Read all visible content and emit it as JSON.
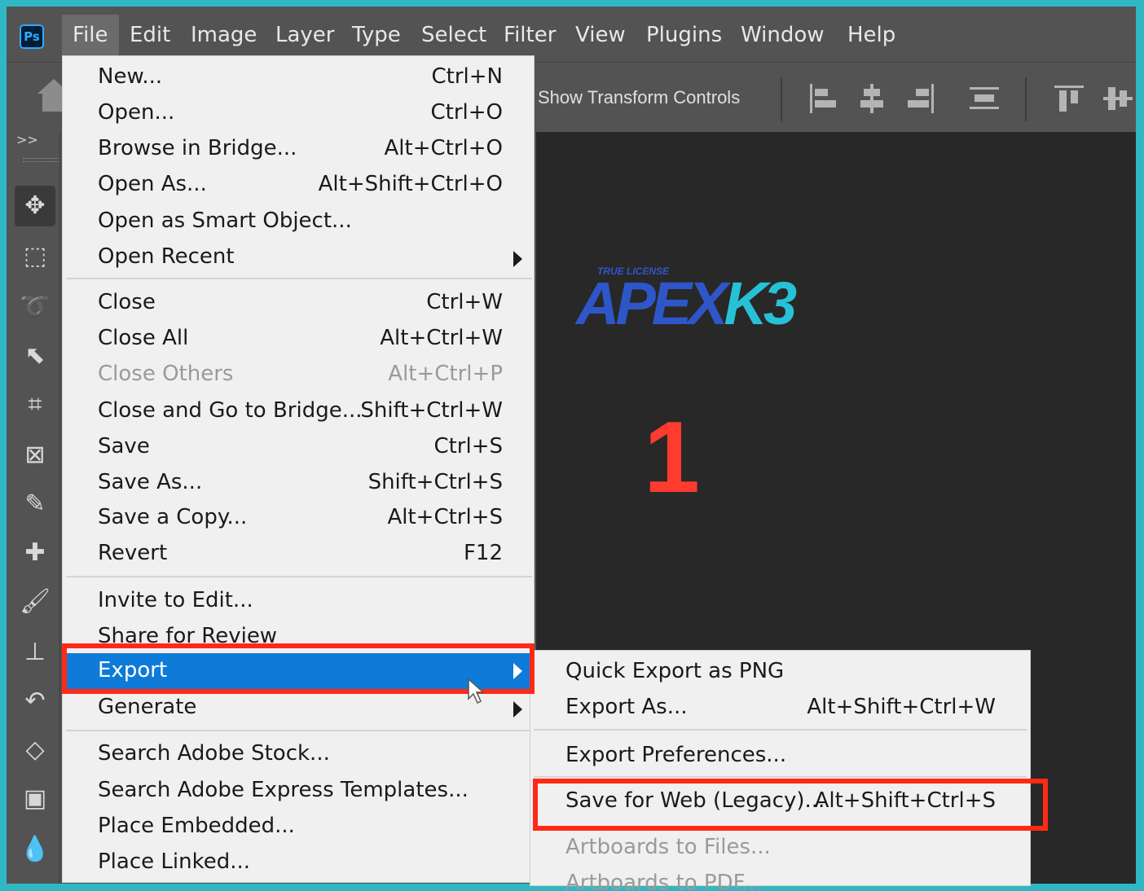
{
  "app": {
    "logo_text": "Ps"
  },
  "menubar": {
    "items": [
      "File",
      "Edit",
      "Image",
      "Layer",
      "Type",
      "Select",
      "Filter",
      "View",
      "Plugins",
      "Window",
      "Help"
    ],
    "active": "File"
  },
  "options_bar": {
    "show_transform_controls": "Show Transform Controls"
  },
  "toolbar": {
    "expand_label": ">>"
  },
  "canvas": {
    "logo_small": "TRUE LICENSE",
    "logo_part1": "APEX",
    "logo_part2": "K3",
    "step_number": "1"
  },
  "file_menu": {
    "new": {
      "label": "New...",
      "shortcut": "Ctrl+N"
    },
    "open": {
      "label": "Open...",
      "shortcut": "Ctrl+O"
    },
    "browse_bridge": {
      "label": "Browse in Bridge...",
      "shortcut": "Alt+Ctrl+O"
    },
    "open_as": {
      "label": "Open As...",
      "shortcut": "Alt+Shift+Ctrl+O"
    },
    "open_smart": {
      "label": "Open as Smart Object..."
    },
    "open_recent": {
      "label": "Open Recent"
    },
    "close": {
      "label": "Close",
      "shortcut": "Ctrl+W"
    },
    "close_all": {
      "label": "Close All",
      "shortcut": "Alt+Ctrl+W"
    },
    "close_others": {
      "label": "Close Others",
      "shortcut": "Alt+Ctrl+P"
    },
    "close_go_bridge": {
      "label": "Close and Go to Bridge...",
      "shortcut": "Shift+Ctrl+W"
    },
    "save": {
      "label": "Save",
      "shortcut": "Ctrl+S"
    },
    "save_as": {
      "label": "Save As...",
      "shortcut": "Shift+Ctrl+S"
    },
    "save_copy": {
      "label": "Save a Copy...",
      "shortcut": "Alt+Ctrl+S"
    },
    "revert": {
      "label": "Revert",
      "shortcut": "F12"
    },
    "invite_edit": {
      "label": "Invite to Edit..."
    },
    "share_review": {
      "label": "Share for Review"
    },
    "export": {
      "label": "Export"
    },
    "generate": {
      "label": "Generate"
    },
    "search_stock": {
      "label": "Search Adobe Stock..."
    },
    "search_express": {
      "label": "Search Adobe Express Templates..."
    },
    "place_embedded": {
      "label": "Place Embedded..."
    },
    "place_linked": {
      "label": "Place Linked..."
    }
  },
  "export_submenu": {
    "quick_export": {
      "label": "Quick Export as PNG"
    },
    "export_as": {
      "label": "Export As...",
      "shortcut": "Alt+Shift+Ctrl+W"
    },
    "export_prefs": {
      "label": "Export Preferences..."
    },
    "save_for_web": {
      "label": "Save for Web (Legacy)...",
      "shortcut": "Alt+Shift+Ctrl+S"
    },
    "artboards_files": {
      "label": "Artboards to Files..."
    },
    "artboards_pdf": {
      "label": "Artboards to PDF..."
    }
  },
  "colors": {
    "frame_border": "#2fb8c4",
    "menu_highlight": "#0f7bd8",
    "annotation_red": "#ff2a16",
    "logo_blue": "#2f56c9",
    "logo_cyan": "#27c1d6"
  }
}
